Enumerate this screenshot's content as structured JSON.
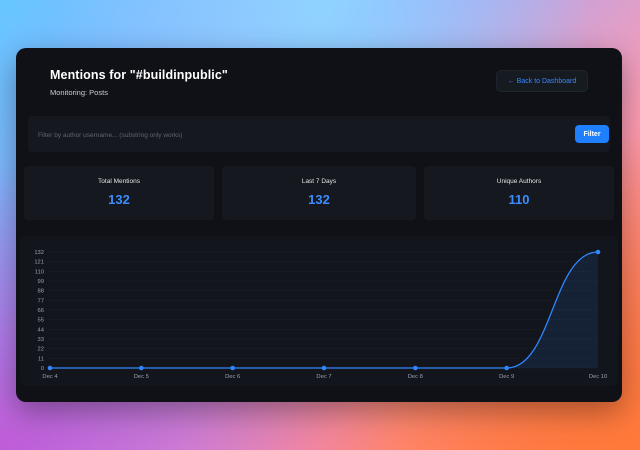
{
  "header": {
    "title": "Mentions for \"#buildinpublic\"",
    "subtitle": "Monitoring: Posts",
    "back_label": "← Back to Dashboard"
  },
  "filter": {
    "placeholder": "Filter by author username... (substring only works)",
    "button_label": "Filter"
  },
  "stats": [
    {
      "label": "Total Mentions",
      "value": "132"
    },
    {
      "label": "Last 7 Days",
      "value": "132"
    },
    {
      "label": "Unique Authors",
      "value": "110"
    }
  ],
  "colors": {
    "accent": "#1e80ff",
    "stat_value": "#3b8cff",
    "panel_bg": "#0f1116",
    "card_bg": "#15181e",
    "line": "#2f86ff"
  },
  "chart_data": {
    "type": "area",
    "categories": [
      "Dec 4",
      "Dec 5",
      "Dec 6",
      "Dec 7",
      "Dec 8",
      "Dec 9",
      "Dec 10"
    ],
    "series": [
      {
        "values": [
          0,
          0,
          0,
          0,
          0,
          0,
          132
        ]
      }
    ],
    "yticks": [
      "132",
      "121",
      "110",
      "99",
      "88",
      "77",
      "66",
      "55",
      "44",
      "33",
      "22",
      "11",
      "0"
    ],
    "ylim": [
      0,
      132
    ],
    "grid": true,
    "legend": "none",
    "title": "",
    "xlabel": "",
    "ylabel": ""
  }
}
